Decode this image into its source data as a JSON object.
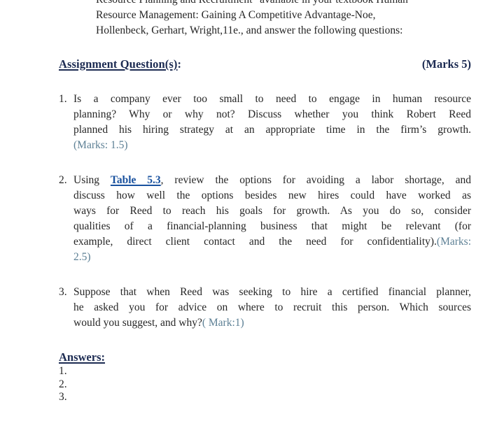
{
  "document": {
    "intro": {
      "line1_clipped": "Resource Planning and Recruitment” available in your textbook Human",
      "line2": "Resource Management: Gaining A Competitive Advantage-Noe,",
      "line3": "Hollenbeck, Gerhart, Wright,11e., and answer the following questions:"
    },
    "heading": {
      "title": "Assignment Question(s)",
      "title_colon": ":",
      "marks": "(Marks 5)"
    },
    "questions": [
      {
        "number": "1.",
        "lines": [
          "Is a company ever too small to need to engage in human resource",
          "planning? Why or why not? Discuss whether you think Robert Reed",
          "planned his hiring strategy at an appropriate time in the firm’s growth."
        ],
        "marks": "(Marks: 1.5)"
      },
      {
        "number": "2.",
        "prefix": "Using ",
        "link": "Table 5.3",
        "lines": [
          ", review the options for avoiding a labor shortage, and",
          "discuss how well the options besides new hires could have worked as",
          "ways for Reed to reach his goals for growth. As you do so, consider",
          "qualities of a financial-planning business that might be relevant (for",
          "example, direct client contact and the need for confidentiality)."
        ],
        "marks_inline": "(Marks:",
        "marks_wrap": "2.5)"
      },
      {
        "number": "3.",
        "lines": [
          "Suppose that when Reed was seeking to hire a certified financial planner,",
          "he asked you for advice on where to recruit this person. Which sources",
          "would you suggest, and why?"
        ],
        "marks": "( Mark:1)"
      }
    ],
    "answers": {
      "title": "Answers:",
      "items": [
        "1.",
        "2.",
        "3."
      ]
    },
    "colors": {
      "heading": "#1c2b52",
      "body": "#262626",
      "marks": "#5d8095",
      "link": "#19519e",
      "background": "#ffffff"
    }
  }
}
